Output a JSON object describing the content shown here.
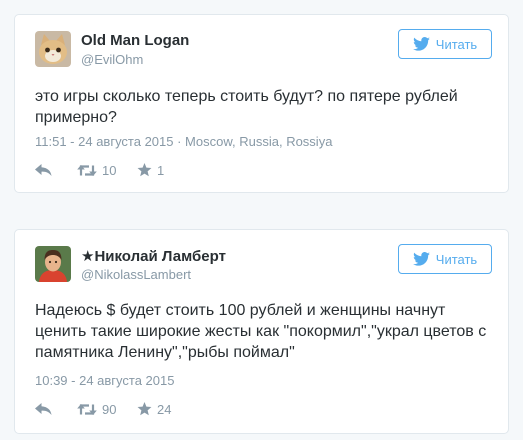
{
  "colors": {
    "accent": "#55acee",
    "text": "#292f33",
    "muted": "#8899a6",
    "border": "#e1e8ed",
    "background": "#f5f8fa"
  },
  "tweets": [
    {
      "name": "Old Man Logan",
      "handle": "@EvilOhm",
      "follow_label": "Читать",
      "text": "это игры сколько теперь стоить будут? по пятере рублей примерно?",
      "meta": "11:51 - 24 августа 2015 · Moscow, Russia, Rossiya",
      "retweets": "10",
      "favorites": "1",
      "avatar_icon": "cat-avatar",
      "icons": [
        "twitter-bird-icon",
        "reply-icon",
        "retweet-icon",
        "star-icon"
      ]
    },
    {
      "name": "★Николай Ламберт",
      "handle": "@NikolassLambert",
      "follow_label": "Читать",
      "text": "Надеюсь $ будет стоить 100 рублей и женщины начнут ценить такие широкие жесты как \"покормил\",\"украл цветов с памятника Ленину\",\"рыбы поймал\"",
      "meta": "10:39 - 24 августа 2015",
      "retweets": "90",
      "favorites": "24",
      "avatar_icon": "person-avatar",
      "icons": [
        "twitter-bird-icon",
        "reply-icon",
        "retweet-icon",
        "star-icon"
      ]
    }
  ]
}
